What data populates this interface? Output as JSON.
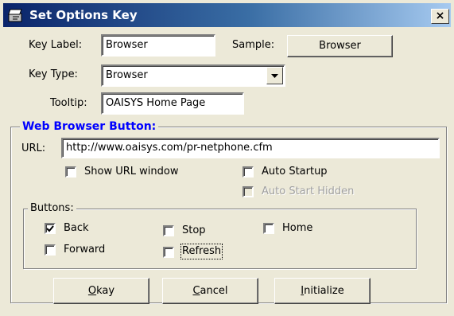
{
  "window": {
    "title": "Set Options Key",
    "close_label": "×"
  },
  "key_label": {
    "label": "Key Label:",
    "value": "Browser"
  },
  "sample": {
    "label": "Sample:",
    "button_label": "Browser"
  },
  "key_type": {
    "label": "Key Type:",
    "value": "Browser"
  },
  "tooltip": {
    "label": "Tooltip:",
    "value": "OAISYS Home Page"
  },
  "web_group": {
    "title": "Web Browser Button:",
    "url_label": "URL:",
    "url_value": "http://www.oaisys.com/pr-netphone.cfm",
    "show_url_window": {
      "label": "Show URL window",
      "checked": false
    },
    "auto_startup": {
      "label": "Auto Startup",
      "checked": false
    },
    "auto_start_hidden": {
      "label": "Auto Start Hidden",
      "checked": false,
      "disabled": true
    }
  },
  "buttons_group": {
    "title": "Buttons:",
    "back": {
      "label": "Back",
      "checked": true
    },
    "stop": {
      "label": "Stop",
      "checked": false
    },
    "home": {
      "label": "Home",
      "checked": false
    },
    "forward": {
      "label": "Forward",
      "checked": false
    },
    "refresh": {
      "label": "Refresh",
      "checked": false
    }
  },
  "actions": {
    "okay": {
      "label": "Okay",
      "accel": "O",
      "rest": "kay"
    },
    "cancel": {
      "label": "Cancel",
      "accel": "C",
      "rest": "ancel"
    },
    "initialize": {
      "label": "Initialize",
      "accel": "I",
      "rest": "nitialize"
    }
  },
  "colors": {
    "group_title": "#0000FF",
    "title_bar_start": "#0A246A",
    "title_bar_end": "#A6CAF0",
    "dialog_face": "#ECE9D8"
  },
  "icons": {
    "title": "keyboard-key-icon",
    "combo": "dropdown-arrow-icon",
    "check": "checkmark-icon"
  }
}
